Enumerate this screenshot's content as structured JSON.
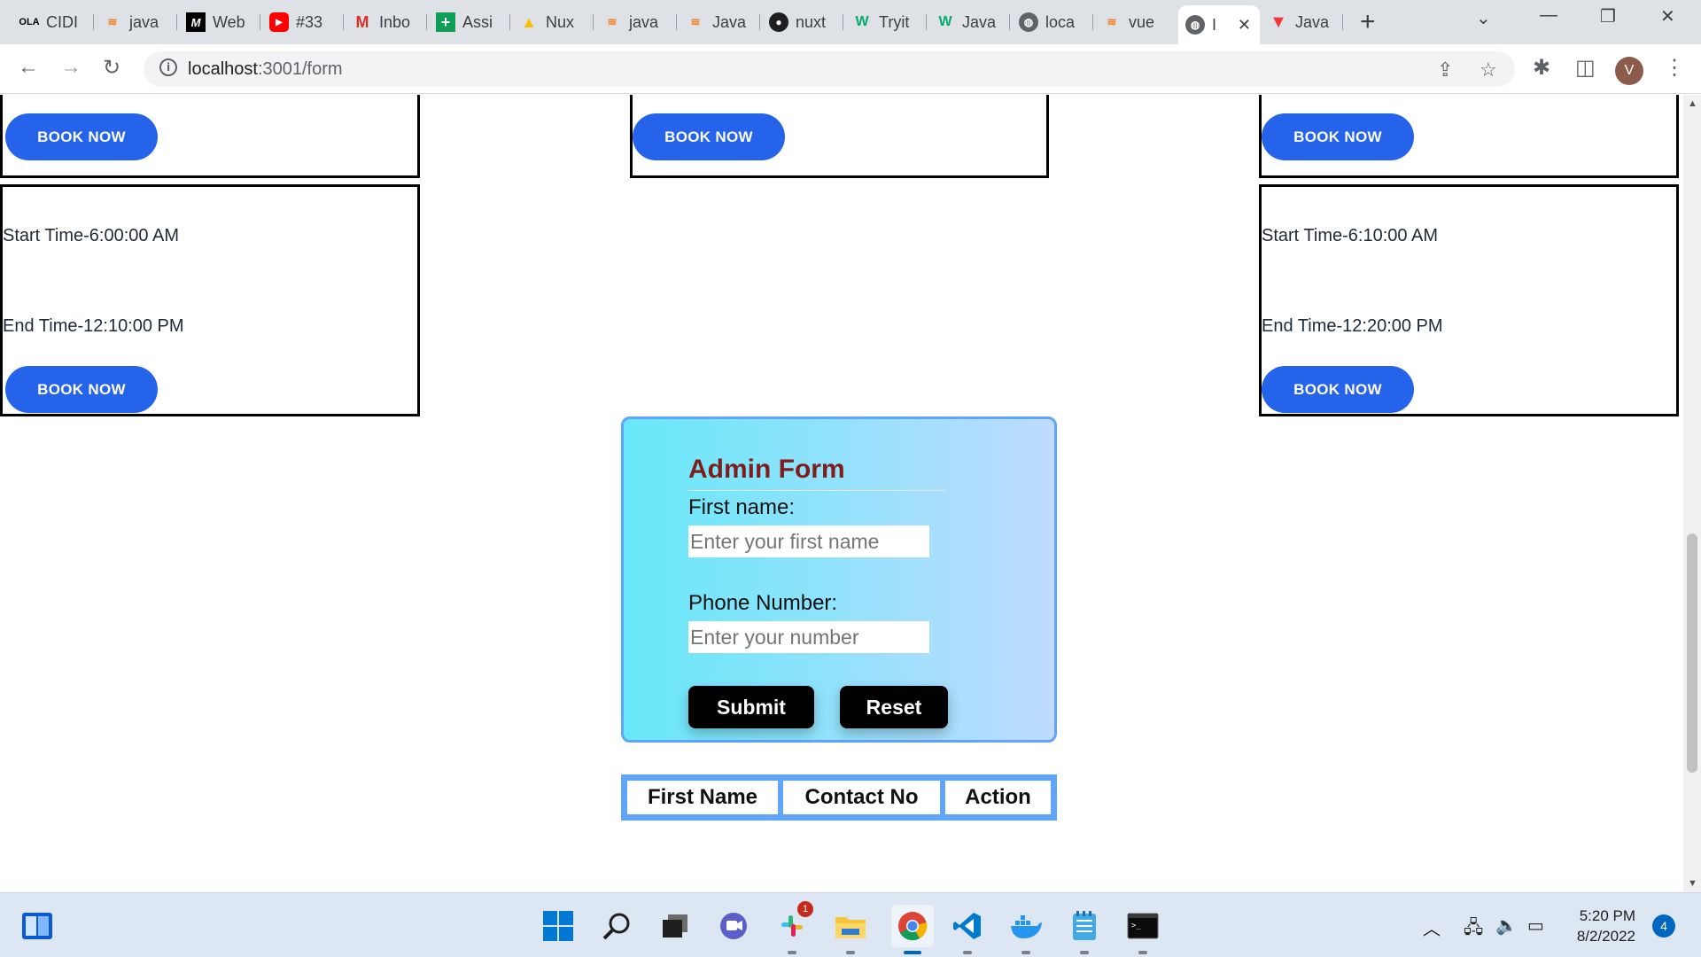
{
  "browser": {
    "tabs": [
      {
        "title": "CIDI",
        "icon": "ola-icon"
      },
      {
        "title": "java",
        "icon": "stackoverflow-icon"
      },
      {
        "title": "Web",
        "icon": "medium-icon"
      },
      {
        "title": "#33",
        "icon": "youtube-icon"
      },
      {
        "title": "Inbo",
        "icon": "gmail-icon"
      },
      {
        "title": "Assi",
        "icon": "sheets-icon"
      },
      {
        "title": "Nux",
        "icon": "drive-icon"
      },
      {
        "title": "java",
        "icon": "stackoverflow-icon"
      },
      {
        "title": "Java",
        "icon": "stackoverflow-icon"
      },
      {
        "title": "nuxt",
        "icon": "github-icon"
      },
      {
        "title": "Tryit",
        "icon": "w3schools-icon"
      },
      {
        "title": "Java",
        "icon": "w3schools-icon"
      },
      {
        "title": "loca",
        "icon": "globe-icon"
      },
      {
        "title": "vue",
        "icon": "stackoverflow-icon"
      },
      {
        "title": "I",
        "icon": "globe-icon"
      },
      {
        "title": "Java",
        "icon": "vivaldi-icon"
      }
    ],
    "active_tab_index": 14,
    "address_host": "localhost",
    "address_path": ":3001/form",
    "profile_initial": "V"
  },
  "cards": {
    "top_left": {
      "button": "BOOK NOW"
    },
    "top_middle": {
      "button": "BOOK NOW"
    },
    "top_right": {
      "button": "BOOK NOW"
    },
    "bottom_left": {
      "start": "Start Time-6:00:00 AM",
      "end": "End Time-12:10:00 PM",
      "button": "BOOK NOW"
    },
    "bottom_right": {
      "start": "Start Time-6:10:00 AM",
      "end": "End Time-12:20:00 PM",
      "button": "BOOK NOW"
    }
  },
  "admin_form": {
    "title": "Admin Form",
    "first_name_label": "First name:",
    "first_name_placeholder": "Enter your first name",
    "phone_label": "Phone Number:",
    "phone_placeholder": "Enter your number",
    "submit_label": "Submit",
    "reset_label": "Reset"
  },
  "table": {
    "headers": [
      "First Name",
      "Contact No",
      "Action"
    ]
  },
  "taskbar": {
    "apps": [
      "widgets-icon",
      "start-icon",
      "search-icon",
      "task-view-icon",
      "teams-chat-icon",
      "slack-icon",
      "file-explorer-icon",
      "chrome-icon",
      "vscode-icon",
      "docker-icon",
      "notepad-icon",
      "terminal-icon"
    ],
    "slack_badge": "1",
    "time": "5:20 PM",
    "date": "8/2/2022",
    "notification_count": "4"
  },
  "colors": {
    "book_button": "#2563eb",
    "form_gradient_start": "#67e8f9",
    "form_gradient_end": "#bfdbfe",
    "form_border": "#60a5fa",
    "form_title": "#7f1d1d"
  }
}
